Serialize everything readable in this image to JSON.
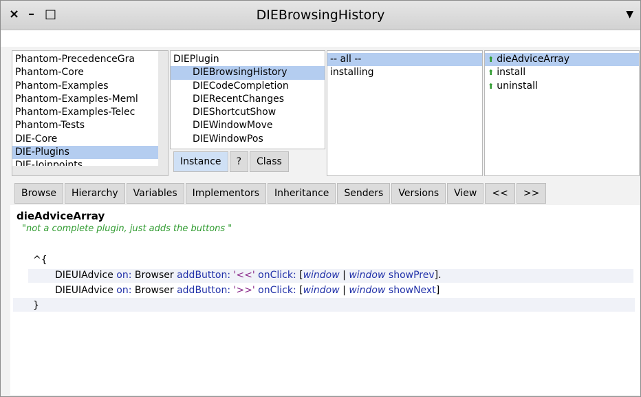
{
  "window": {
    "title": "DIEBrowsingHistory",
    "close_glyph": "×",
    "minimize_glyph": "–",
    "maximize_glyph": "□",
    "menu_glyph": "▼"
  },
  "packages": {
    "items": [
      "Phantom-PrecedenceGra",
      "Phantom-Core",
      "Phantom-Examples",
      "Phantom-Examples-Meml",
      "Phantom-Examples-Telec",
      "Phantom-Tests",
      "DIE-Core",
      "DIE-Plugins",
      "DIE-Joinpoints"
    ],
    "selected": "DIE-Plugins"
  },
  "classes": {
    "items": [
      "DIEPlugin",
      "DIEBrowsingHistory",
      "DIECodeCompletion",
      "DIERecentChanges",
      "DIEShortcutShow",
      "DIEWindowMove",
      "DIEWindowPos"
    ],
    "selected": "DIEBrowsingHistory"
  },
  "class_side_buttons": {
    "instance": "Instance",
    "help": "?",
    "class": "Class"
  },
  "protocols": {
    "items": [
      "-- all --",
      "installing"
    ],
    "selected": "-- all --"
  },
  "methods": {
    "items": [
      "dieAdviceArray",
      "install",
      "uninstall"
    ],
    "selected": "dieAdviceArray",
    "marker_icon": "green-up-arrow-icon"
  },
  "toolbar": [
    "Browse",
    "Hierarchy",
    "Variables",
    "Implementors",
    "Inheritance",
    "Senders",
    "Versions",
    "View",
    "<<",
    ">>"
  ],
  "code": {
    "selector": "dieAdviceArray",
    "comment": "\"not a complete plugin, just adds the buttons \"",
    "open": "^{",
    "line1": {
      "cls": "DIEUIAdvice",
      "on": "on:",
      "recv": "Browser",
      "kw1": "addButton:",
      "str": "'<<'",
      "kw2": "onClick:",
      "lb": "[",
      "arg": "window",
      "bar": "|",
      "var": "window",
      "msg": "showPrev",
      "end": "]."
    },
    "line2": {
      "cls": "DIEUIAdvice",
      "on": "on:",
      "recv": "Browser",
      "kw1": "addButton:",
      "str": "'>>'",
      "kw2": "onClick:",
      "lb": "[",
      "arg": "window",
      "bar": "|",
      "var": "window",
      "msg": "showNext",
      "end": "]"
    },
    "close": "}"
  }
}
